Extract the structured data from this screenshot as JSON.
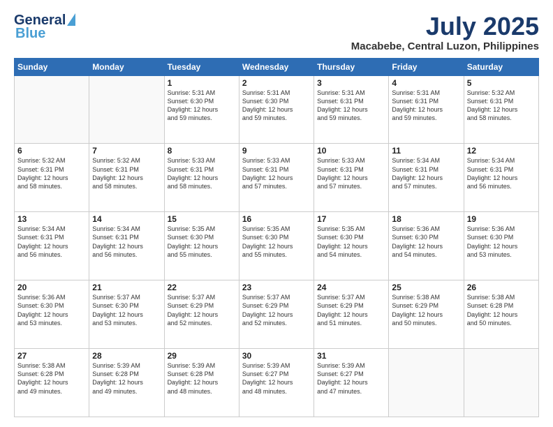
{
  "header": {
    "logo_line1": "General",
    "logo_line2": "Blue",
    "title": "July 2025",
    "subtitle": "Macabebe, Central Luzon, Philippines"
  },
  "days_of_week": [
    "Sunday",
    "Monday",
    "Tuesday",
    "Wednesday",
    "Thursday",
    "Friday",
    "Saturday"
  ],
  "weeks": [
    [
      {
        "day": "",
        "info": ""
      },
      {
        "day": "",
        "info": ""
      },
      {
        "day": "1",
        "info": "Sunrise: 5:31 AM\nSunset: 6:30 PM\nDaylight: 12 hours\nand 59 minutes."
      },
      {
        "day": "2",
        "info": "Sunrise: 5:31 AM\nSunset: 6:30 PM\nDaylight: 12 hours\nand 59 minutes."
      },
      {
        "day": "3",
        "info": "Sunrise: 5:31 AM\nSunset: 6:31 PM\nDaylight: 12 hours\nand 59 minutes."
      },
      {
        "day": "4",
        "info": "Sunrise: 5:31 AM\nSunset: 6:31 PM\nDaylight: 12 hours\nand 59 minutes."
      },
      {
        "day": "5",
        "info": "Sunrise: 5:32 AM\nSunset: 6:31 PM\nDaylight: 12 hours\nand 58 minutes."
      }
    ],
    [
      {
        "day": "6",
        "info": "Sunrise: 5:32 AM\nSunset: 6:31 PM\nDaylight: 12 hours\nand 58 minutes."
      },
      {
        "day": "7",
        "info": "Sunrise: 5:32 AM\nSunset: 6:31 PM\nDaylight: 12 hours\nand 58 minutes."
      },
      {
        "day": "8",
        "info": "Sunrise: 5:33 AM\nSunset: 6:31 PM\nDaylight: 12 hours\nand 58 minutes."
      },
      {
        "day": "9",
        "info": "Sunrise: 5:33 AM\nSunset: 6:31 PM\nDaylight: 12 hours\nand 57 minutes."
      },
      {
        "day": "10",
        "info": "Sunrise: 5:33 AM\nSunset: 6:31 PM\nDaylight: 12 hours\nand 57 minutes."
      },
      {
        "day": "11",
        "info": "Sunrise: 5:34 AM\nSunset: 6:31 PM\nDaylight: 12 hours\nand 57 minutes."
      },
      {
        "day": "12",
        "info": "Sunrise: 5:34 AM\nSunset: 6:31 PM\nDaylight: 12 hours\nand 56 minutes."
      }
    ],
    [
      {
        "day": "13",
        "info": "Sunrise: 5:34 AM\nSunset: 6:31 PM\nDaylight: 12 hours\nand 56 minutes."
      },
      {
        "day": "14",
        "info": "Sunrise: 5:34 AM\nSunset: 6:31 PM\nDaylight: 12 hours\nand 56 minutes."
      },
      {
        "day": "15",
        "info": "Sunrise: 5:35 AM\nSunset: 6:30 PM\nDaylight: 12 hours\nand 55 minutes."
      },
      {
        "day": "16",
        "info": "Sunrise: 5:35 AM\nSunset: 6:30 PM\nDaylight: 12 hours\nand 55 minutes."
      },
      {
        "day": "17",
        "info": "Sunrise: 5:35 AM\nSunset: 6:30 PM\nDaylight: 12 hours\nand 54 minutes."
      },
      {
        "day": "18",
        "info": "Sunrise: 5:36 AM\nSunset: 6:30 PM\nDaylight: 12 hours\nand 54 minutes."
      },
      {
        "day": "19",
        "info": "Sunrise: 5:36 AM\nSunset: 6:30 PM\nDaylight: 12 hours\nand 53 minutes."
      }
    ],
    [
      {
        "day": "20",
        "info": "Sunrise: 5:36 AM\nSunset: 6:30 PM\nDaylight: 12 hours\nand 53 minutes."
      },
      {
        "day": "21",
        "info": "Sunrise: 5:37 AM\nSunset: 6:30 PM\nDaylight: 12 hours\nand 53 minutes."
      },
      {
        "day": "22",
        "info": "Sunrise: 5:37 AM\nSunset: 6:29 PM\nDaylight: 12 hours\nand 52 minutes."
      },
      {
        "day": "23",
        "info": "Sunrise: 5:37 AM\nSunset: 6:29 PM\nDaylight: 12 hours\nand 52 minutes."
      },
      {
        "day": "24",
        "info": "Sunrise: 5:37 AM\nSunset: 6:29 PM\nDaylight: 12 hours\nand 51 minutes."
      },
      {
        "day": "25",
        "info": "Sunrise: 5:38 AM\nSunset: 6:29 PM\nDaylight: 12 hours\nand 50 minutes."
      },
      {
        "day": "26",
        "info": "Sunrise: 5:38 AM\nSunset: 6:28 PM\nDaylight: 12 hours\nand 50 minutes."
      }
    ],
    [
      {
        "day": "27",
        "info": "Sunrise: 5:38 AM\nSunset: 6:28 PM\nDaylight: 12 hours\nand 49 minutes."
      },
      {
        "day": "28",
        "info": "Sunrise: 5:39 AM\nSunset: 6:28 PM\nDaylight: 12 hours\nand 49 minutes."
      },
      {
        "day": "29",
        "info": "Sunrise: 5:39 AM\nSunset: 6:28 PM\nDaylight: 12 hours\nand 48 minutes."
      },
      {
        "day": "30",
        "info": "Sunrise: 5:39 AM\nSunset: 6:27 PM\nDaylight: 12 hours\nand 48 minutes."
      },
      {
        "day": "31",
        "info": "Sunrise: 5:39 AM\nSunset: 6:27 PM\nDaylight: 12 hours\nand 47 minutes."
      },
      {
        "day": "",
        "info": ""
      },
      {
        "day": "",
        "info": ""
      }
    ]
  ]
}
